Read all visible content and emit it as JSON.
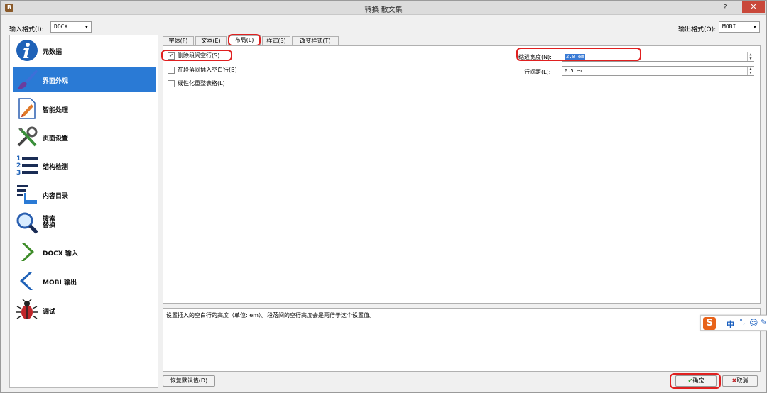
{
  "window": {
    "title": "转换 散文集",
    "help_label": "?",
    "close_label": "✕"
  },
  "top": {
    "input_label": "输入格式(I):",
    "input_value": "DOCX",
    "output_label": "输出格式(O):",
    "output_value": "MOBI"
  },
  "sidebar": {
    "items": [
      {
        "label": "元数据",
        "icon": "info-icon"
      },
      {
        "label": "界面外观",
        "icon": "brush-icon",
        "selected": true
      },
      {
        "label": "智能处理",
        "icon": "document-edit-icon"
      },
      {
        "label": "页面设置",
        "icon": "tools-icon"
      },
      {
        "label": "结构检测",
        "icon": "numbered-list-icon"
      },
      {
        "label": "内容目录",
        "icon": "toc-icon"
      },
      {
        "label": "搜索\n替换",
        "icon": "magnifier-icon"
      },
      {
        "label": "DOCX 输入",
        "icon": "chevron-right-icon"
      },
      {
        "label": "MOBI 输出",
        "icon": "chevron-left-icon"
      },
      {
        "label": "调试",
        "icon": "bug-icon"
      }
    ]
  },
  "tabs": [
    {
      "label": "字体(F)"
    },
    {
      "label": "文本(E)"
    },
    {
      "label": "布局(L)",
      "active": true
    },
    {
      "label": "样式(S)"
    },
    {
      "label": "改变样式(T)"
    }
  ],
  "layout": {
    "remove_spacing_label": "删除段间空行(S)",
    "remove_spacing_checked": true,
    "insert_blank_label": "在段落间插入空白行(B)",
    "insert_blank_checked": false,
    "linearize_tables_label": "线性化重整表格(L)",
    "linearize_tables_checked": false,
    "indent_label": "缩进宽度(N):",
    "indent_value": "2.0 em",
    "line_spacing_label": "行间距(L):",
    "line_spacing_value": "0.5 em"
  },
  "help_text": "设置插入的空白行的高度（单位: em）。段落间的空行高度会是两倍于这个设置值。",
  "ime": {
    "logo": "S",
    "lang": "中",
    "punct": "°,",
    "emoji": "☺",
    "tool": "✎"
  },
  "buttons": {
    "restore_defaults": "恢复默认值(D)",
    "ok": "确定",
    "ok_icon": "✔",
    "cancel": "取消",
    "cancel_icon": "✖"
  },
  "colors": {
    "selection_blue": "#2a7ad5",
    "annotation_red": "#e02020"
  }
}
